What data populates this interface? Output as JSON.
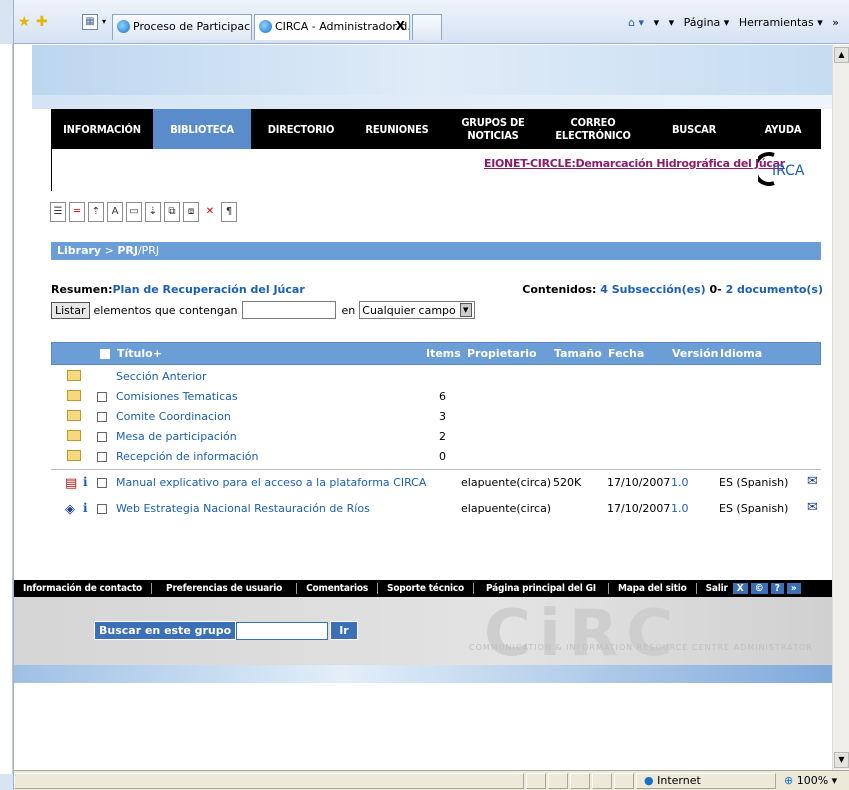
{
  "tabs": [
    {
      "label": "Proceso de Participación del ..."
    },
    {
      "label": "CIRCA - Administrador d...",
      "close": "X"
    }
  ],
  "toolbar_right": {
    "home": "⌂ ▾",
    "feeds": "▾",
    "print": "▾",
    "page": "Página ▾",
    "tools": "Herramientas ▾",
    "more": "»"
  },
  "nav": [
    {
      "label": "INFORMACIÓN"
    },
    {
      "label": "BIBLIOTECA",
      "active": true
    },
    {
      "label": "DIRECTORIO"
    },
    {
      "label": "REUNIONES"
    },
    {
      "label": "GRUPOS DE NOTICIAS"
    },
    {
      "label": "CORREO ELECTRÓNICO"
    },
    {
      "label": "BUSCAR"
    },
    {
      "label": "AYUDA"
    }
  ],
  "group_link": "EIONET-CIRCLE:Demarcación Hidrográfica del Júcar",
  "logo_text": "IRCA",
  "breadcrumb": {
    "root": "Library",
    "sep": " > ",
    "current": "PRJ",
    "tail": "/PRJ"
  },
  "resumen": {
    "label": "Resumen:",
    "value": "Plan de Recuperación del Júcar"
  },
  "contenidos": {
    "label": "Contenidos:",
    "subsections": "4 Subsección(es)",
    "mid": " 0- ",
    "documents": "2 documento(s)"
  },
  "search_row": {
    "button": "Listar",
    "label": "elementos que contengan",
    "en": "en",
    "select_value": "Cualquier campo"
  },
  "table": {
    "headers": {
      "titulo": "Título+",
      "items": "Items",
      "propietario": "Propietario",
      "tamano": "Tamaño",
      "fecha": "Fecha",
      "version": "Versión",
      "idioma": "Idioma"
    },
    "up": "Sección Anterior",
    "folders": [
      {
        "title": "Comisiones Tematicas",
        "items": "6"
      },
      {
        "title": "Comite Coordinacion",
        "items": "3"
      },
      {
        "title": "Mesa de participación",
        "items": "2"
      },
      {
        "title": "Recepción de información",
        "items": "0"
      }
    ],
    "documents": [
      {
        "title": "Manual explicativo para el acceso a la plataforma CIRCA",
        "owner": "elapuente(circa)",
        "size": "520K",
        "date": "17/10/2007",
        "version": "1.0",
        "lang": "ES (Spanish)"
      },
      {
        "title": "Web Estrategia Nacional Restauración de Ríos",
        "owner": "elapuente(circa)",
        "size": "",
        "date": "17/10/2007",
        "version": "1.0",
        "lang": "ES (Spanish)"
      }
    ],
    "info": "i"
  },
  "footer": [
    "Información de contacto",
    "Preferencias de usuario",
    "Comentarios",
    "Soporte técnico",
    "Página principal del GI",
    "Mapa del sitio",
    "Salir"
  ],
  "footer_icons": [
    "X",
    "©",
    "?",
    "»"
  ],
  "bottom_search": {
    "label": "Buscar en este grupo",
    "go": "Ir"
  },
  "watermark": "COMMUNICATION & INFORMATION RESOURCE CENTRE ADMINISTRATOR",
  "status": {
    "zone": "Internet",
    "zoom": "100%"
  }
}
